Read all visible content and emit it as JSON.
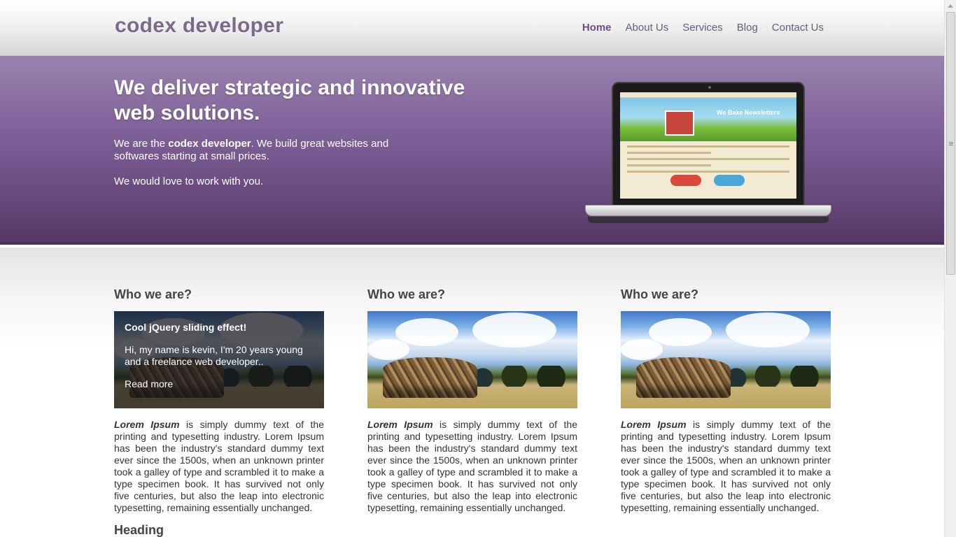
{
  "header": {
    "logo": "codex developer",
    "nav": [
      {
        "label": "Home",
        "active": true
      },
      {
        "label": "About Us",
        "active": false
      },
      {
        "label": "Services",
        "active": false
      },
      {
        "label": "Blog",
        "active": false
      },
      {
        "label": "Contact Us",
        "active": false
      }
    ]
  },
  "hero": {
    "headline": "We deliver strategic and innovative web solutions.",
    "intro_prefix": "We are the ",
    "intro_brand": "codex developer",
    "intro_suffix": ". We build great websites and softwares starting at small prices.",
    "line2": "We would love to work with you.",
    "laptop_screen": {
      "title": "We Bake Newsletters"
    }
  },
  "columns": [
    {
      "heading": "Who we are?",
      "overlay": {
        "title": "Cool jQuery sliding effect!",
        "text": "Hi, my name is kevin, I'm 20 years young and a freelance web developer..",
        "link": "Read more"
      },
      "body_bold": "Lorem Ipsum",
      "body_text": " is simply dummy text of the printing and typesetting industry. Lorem Ipsum has been the industry's standard dummy text ever since the 1500s, when an unknown printer took a galley of type and scrambled it to make a type specimen book. It has survived not only five centuries, but also the leap into electronic typesetting, remaining essentially unchanged."
    },
    {
      "heading": "Who we are?",
      "body_bold": "Lorem Ipsum",
      "body_text": " is simply dummy text of the printing and typesetting industry. Lorem Ipsum has been the industry's standard dummy text ever since the 1500s, when an unknown printer took a galley of type and scrambled it to make a type specimen book. It has survived not only five centuries, but also the leap into electronic typesetting, remaining essentially unchanged."
    },
    {
      "heading": "Who we are?",
      "body_bold": "Lorem Ipsum",
      "body_text": " is simply dummy text of the printing and typesetting industry. Lorem Ipsum has been the industry's standard dummy text ever since the 1500s, when an unknown printer took a galley of type and scrambled it to make a type specimen book. It has survived not only five centuries, but also the leap into electronic typesetting, remaining essentially unchanged."
    }
  ],
  "section2": {
    "heading": "Heading"
  },
  "colors": {
    "brand_purple": "#7f6299",
    "nav_text": "#6c5b7b",
    "heading_text": "#444444"
  }
}
